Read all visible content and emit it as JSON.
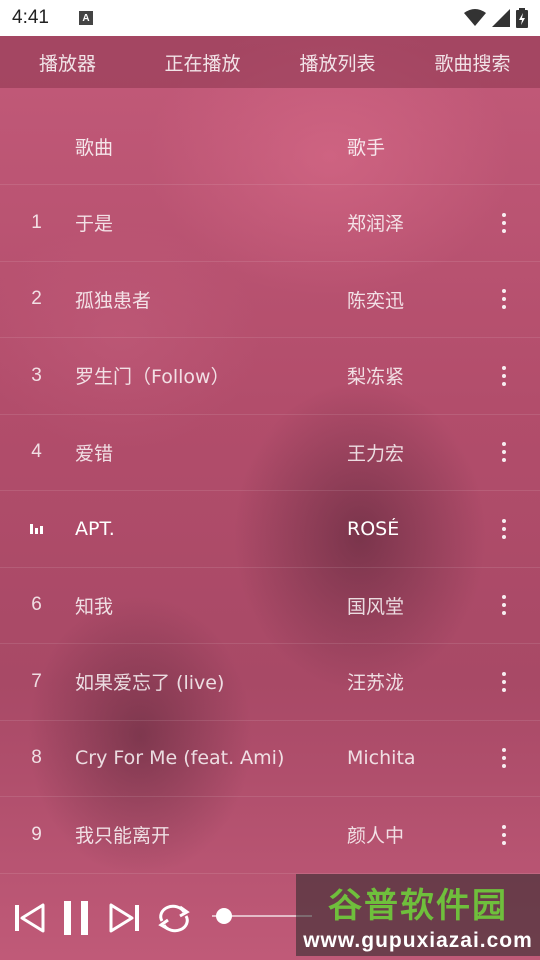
{
  "status": {
    "time": "4:41",
    "a_badge": "A"
  },
  "tabs": [
    {
      "label": "播放器"
    },
    {
      "label": "正在播放"
    },
    {
      "label": "播放列表"
    },
    {
      "label": "歌曲搜索"
    }
  ],
  "columns": {
    "title": "歌曲",
    "artist": "歌手"
  },
  "songs": [
    {
      "num": "1",
      "title": "于是",
      "artist": "郑润泽"
    },
    {
      "num": "2",
      "title": "孤独患者",
      "artist": "陈奕迅"
    },
    {
      "num": "3",
      "title": "罗生门（Follow）",
      "artist": "梨冻紧"
    },
    {
      "num": "4",
      "title": "爱错",
      "artist": "王力宏"
    },
    {
      "num": "",
      "title": "APT.",
      "artist": "ROSÉ"
    },
    {
      "num": "6",
      "title": "知我",
      "artist": "国风堂"
    },
    {
      "num": "7",
      "title": "如果爱忘了 (live)",
      "artist": "汪苏泷"
    },
    {
      "num": "8",
      "title": "Cry For Me (feat. Ami)",
      "artist": "Michita"
    },
    {
      "num": "9",
      "title": "我只能离开",
      "artist": "颜人中"
    }
  ],
  "now_playing_index": 5,
  "icons": {
    "prev": "skip-previous-icon",
    "pause": "pause-icon",
    "next": "skip-next-icon",
    "repeat": "repeat-icon",
    "more": "more-vertical-icon",
    "playing": "equalizer-icon"
  },
  "watermark": {
    "cn": "谷普软件园",
    "url": "www.gupuxiazai.com"
  },
  "colors": {
    "accent": "#b34e6a",
    "watermark_green": "#6fbf3c"
  }
}
